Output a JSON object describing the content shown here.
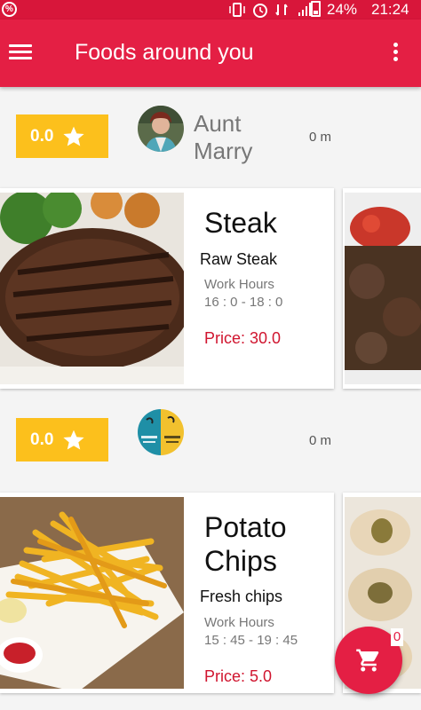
{
  "status_bar": {
    "battery_percent": "24%",
    "time": "21:24"
  },
  "app_bar": {
    "title": "Foods around you",
    "menu_icon": "hamburger-menu-icon",
    "overflow_icon": "more-vert-icon"
  },
  "restaurants": [
    {
      "rating": "0.0",
      "name": "Aunt Marry",
      "distance": "0 m",
      "foods": [
        {
          "name": "Steak",
          "description": "Raw Steak",
          "work_hours_label": "Work Hours",
          "work_hours": "16 : 0 - 18 : 0",
          "price": "Price: 30.0"
        }
      ]
    },
    {
      "rating": "0.0",
      "name": "",
      "distance": "0 m",
      "foods": [
        {
          "name": "Potato Chips",
          "description": "Fresh chips",
          "work_hours_label": "Work Hours",
          "work_hours": "15 : 45 - 19 : 45",
          "price": "Price: 5.0"
        }
      ]
    }
  ],
  "cart": {
    "icon": "shopping-cart-icon",
    "badge": "0"
  },
  "colors": {
    "primary": "#e41f44",
    "status_bar": "#d8163a",
    "rating": "#fcc01c",
    "price": "#d0152f"
  }
}
